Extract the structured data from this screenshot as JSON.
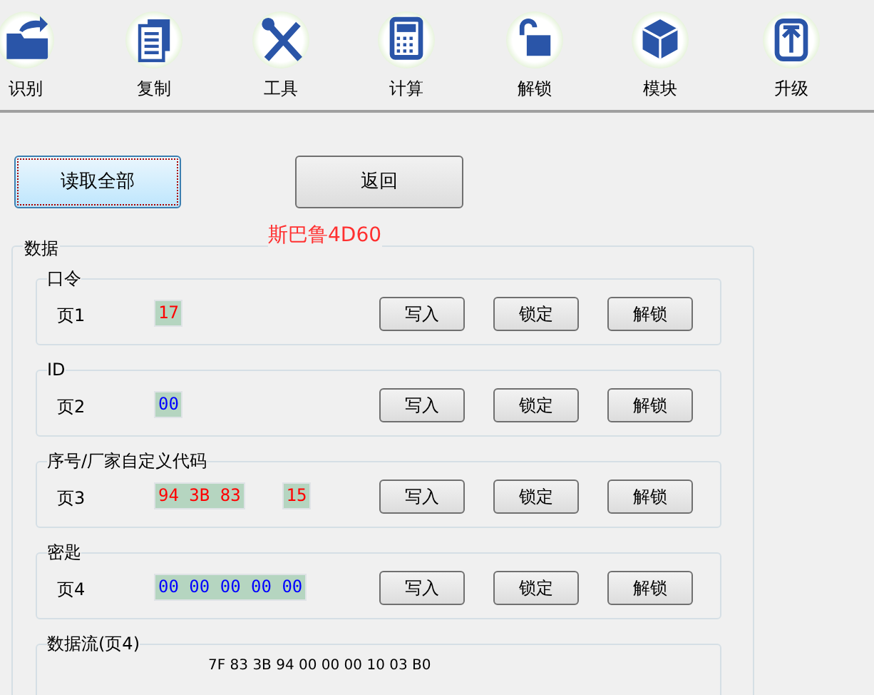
{
  "toolbar": [
    {
      "label": "识别"
    },
    {
      "label": "复制"
    },
    {
      "label": "工具"
    },
    {
      "label": "计算"
    },
    {
      "label": "解锁"
    },
    {
      "label": "模块"
    },
    {
      "label": "升级"
    }
  ],
  "actions": [
    {
      "label": "读取全部",
      "selected": true
    },
    {
      "label": "返回",
      "selected": false
    }
  ],
  "vehicle": "斯巴鲁4D60",
  "data_group": {
    "title": "数据",
    "sections": [
      {
        "title": "口令",
        "page": "页1",
        "fields": [
          {
            "value": "17",
            "color": "#ff0000"
          }
        ],
        "buttons": [
          "写入",
          "锁定",
          "解锁"
        ]
      },
      {
        "title": "ID",
        "page": "页2",
        "fields": [
          {
            "value": "00",
            "color": "#0000ff"
          }
        ],
        "buttons": [
          "写入",
          "锁定",
          "解锁"
        ]
      },
      {
        "title": "序号/厂家自定义代码",
        "page": "页3",
        "fields": [
          {
            "value": "94 3B 83",
            "color": "#ff0000"
          },
          {
            "value": "15",
            "color": "#ff0000"
          }
        ],
        "buttons": [
          "写入",
          "锁定",
          "解锁"
        ]
      },
      {
        "title": "密匙",
        "page": "页4",
        "fields": [
          {
            "value": "00 00 00 00 00",
            "color": "#0000ff"
          }
        ],
        "buttons": [
          "写入",
          "锁定",
          "解锁"
        ]
      }
    ],
    "stream": {
      "title": "数据流(页4)",
      "text": "7F 83 3B 94 00 00 00 10 03 B0"
    }
  }
}
